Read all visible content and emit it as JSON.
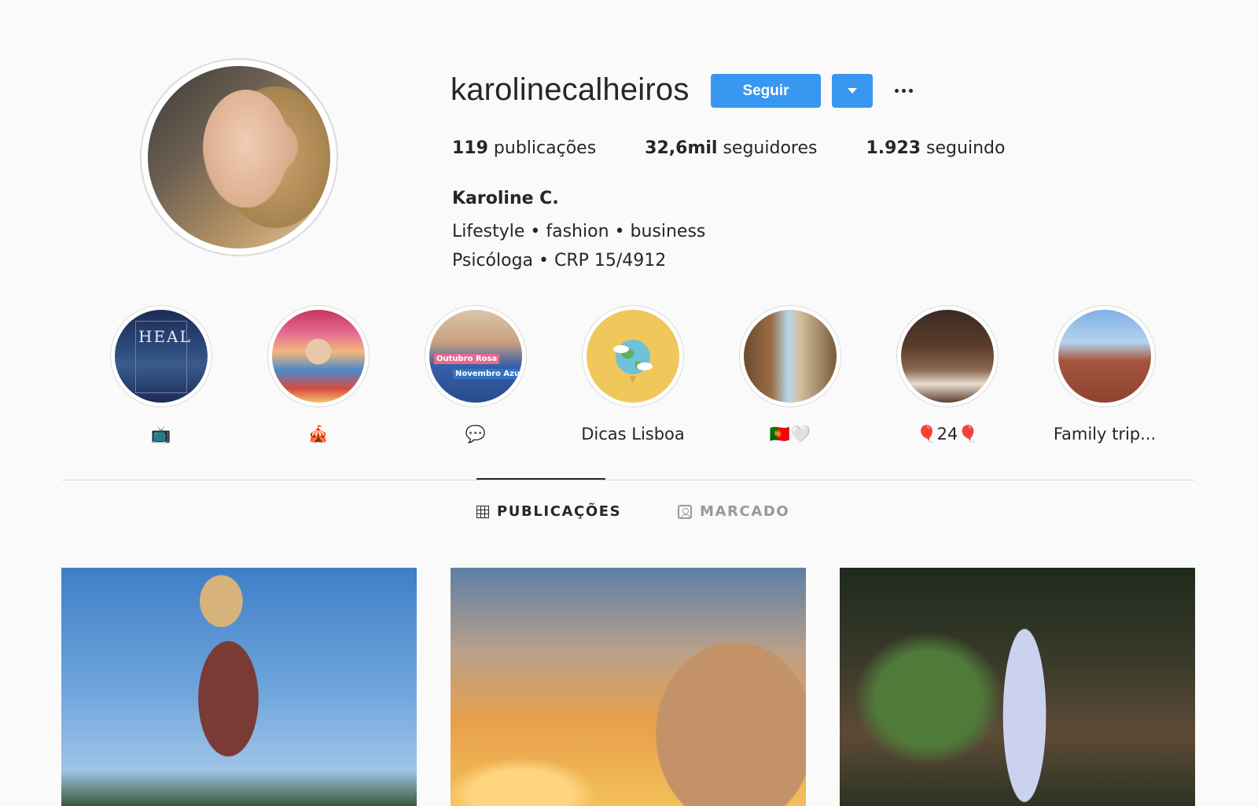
{
  "profile": {
    "username": "karolinecalheiros",
    "follow_label": "Seguir",
    "stats": {
      "posts_count": "119",
      "posts_label": " publicações",
      "followers_count": "32,6mil",
      "followers_label": " seguidores",
      "following_count": "1.923",
      "following_label": " seguindo"
    },
    "full_name": "Karoline C.",
    "bio_line1": "Lifestyle • fashion • business",
    "bio_line2": "Psicóloga • CRP 15/4912"
  },
  "highlights": [
    {
      "label": "📺",
      "image": "heal-cover"
    },
    {
      "label": "🎪",
      "image": "carnival"
    },
    {
      "label": "💬",
      "image": "outubro-rosa"
    },
    {
      "label": "Dicas Lisboa",
      "image": "globe"
    },
    {
      "label": "🇵🇹🤍",
      "image": "street"
    },
    {
      "label": "🎈24🎈",
      "image": "party"
    },
    {
      "label": "Family trip...",
      "image": "building"
    }
  ],
  "highlight_text": {
    "heal": "HEAL",
    "outubro": "Outubro Rosa",
    "novembro": "Novembro Azul"
  },
  "tabs": {
    "posts": "PUBLICAÇÕES",
    "tagged": "MARCADO"
  },
  "colors": {
    "accent": "#3897f0",
    "text": "#262626",
    "muted": "#999999",
    "background": "#fafafa"
  }
}
